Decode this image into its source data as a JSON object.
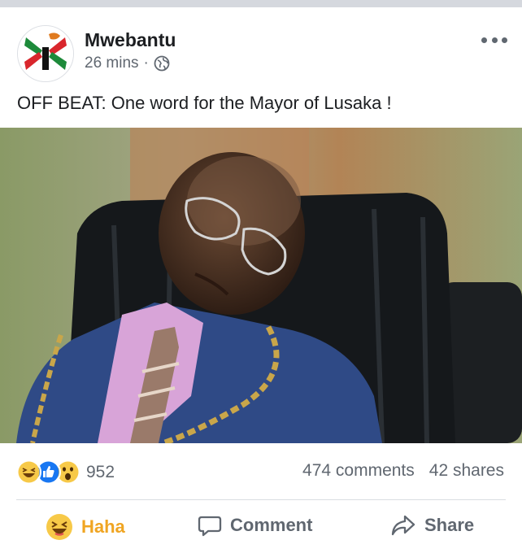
{
  "post": {
    "author": "Mwebantu",
    "time": "26 mins",
    "separator": "·",
    "privacy_icon": "globe-icon",
    "text": "OFF BEAT: One word for the Mayor of Lusaka !",
    "more_icon": "more-horizontal-icon"
  },
  "stats": {
    "reaction_icons": [
      "haha-icon",
      "like-icon",
      "wow-icon"
    ],
    "reaction_count": "952",
    "comments": "474 comments",
    "shares": "42 shares"
  },
  "actions": {
    "haha_label": "Haha",
    "comment_label": "Comment",
    "share_label": "Share"
  },
  "colors": {
    "haha_active": "#f0a522",
    "like_blue": "#1877f2",
    "text_secondary": "#606770"
  }
}
